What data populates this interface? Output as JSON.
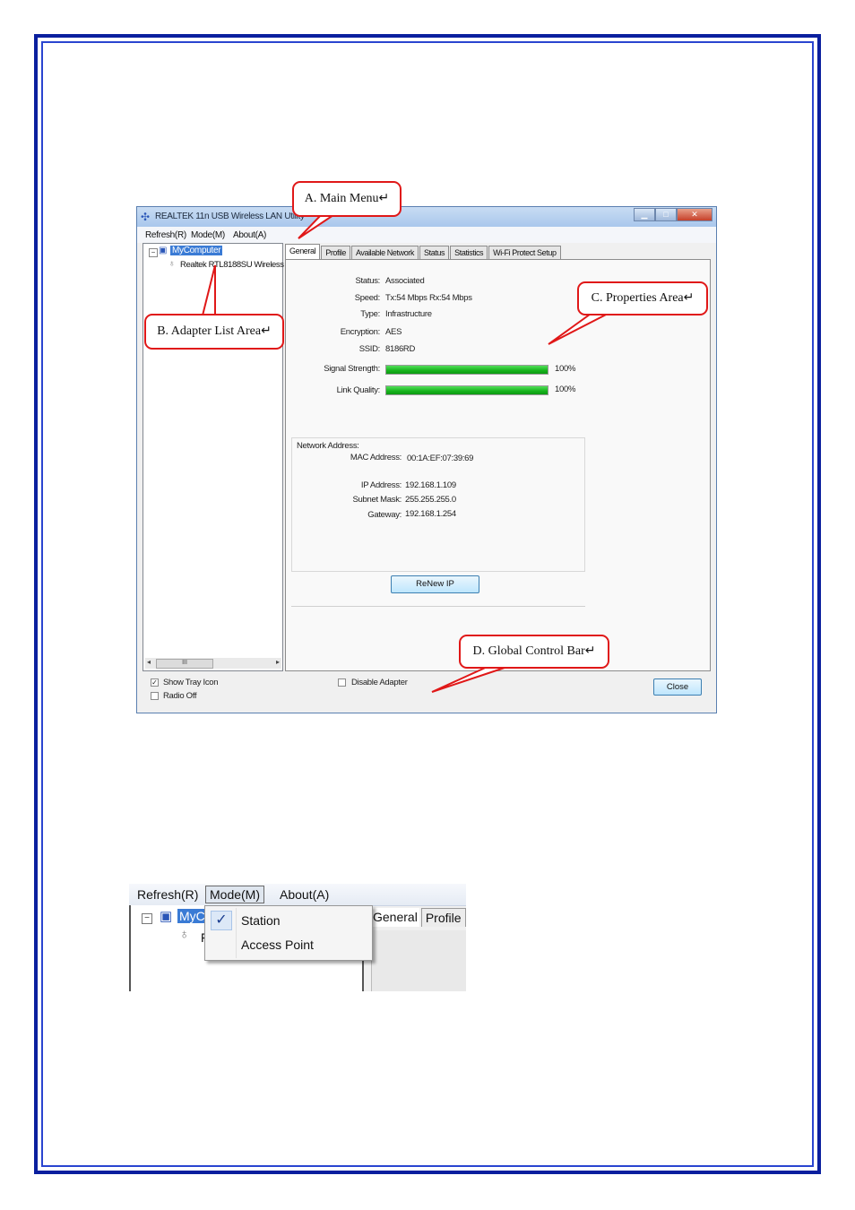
{
  "window": {
    "title": "REALTEK 11n USB Wireless LAN Utility",
    "controls": {
      "minimize": "▁",
      "maximize": "□",
      "close": "✕"
    }
  },
  "menu": {
    "refresh": "Refresh(R)",
    "mode": "Mode(M)",
    "about": "About(A)"
  },
  "adapter_list": {
    "root": "MyComputer",
    "child": "Realtek RTL8188SU Wireless",
    "scroll_thumb": "III"
  },
  "tabs": [
    "General",
    "Profile",
    "Available Network",
    "Status",
    "Statistics",
    "Wi-Fi Protect Setup"
  ],
  "general": {
    "status_label": "Status:",
    "status": "Associated",
    "speed_label": "Speed:",
    "speed": "Tx:54 Mbps Rx:54 Mbps",
    "type_label": "Type:",
    "type": "Infrastructure",
    "encryption_label": "Encryption:",
    "encryption": "AES",
    "ssid_label": "SSID:",
    "ssid": "8186RD",
    "signal_label": "Signal Strength:",
    "signal_text": "100%",
    "signal_value": 100,
    "link_label": "Link Quality:",
    "link_text": "100%",
    "link_value": 100
  },
  "network_address": {
    "heading": "Network Address:",
    "mac_label": "MAC Address:",
    "mac": "00:1A:EF:07:39:69",
    "ip_label": "IP Address:",
    "ip": "192.168.1.109",
    "mask_label": "Subnet Mask:",
    "mask": "255.255.255.0",
    "gateway_label": "Gateway:",
    "gateway": "192.168.1.254"
  },
  "renew_button": "ReNew IP",
  "global_bar": {
    "show_tray": "Show Tray Icon",
    "show_tray_checked": true,
    "radio_off": "Radio Off",
    "radio_off_checked": false,
    "disable_adapter": "Disable Adapter",
    "disable_adapter_checked": false,
    "close": "Close"
  },
  "callouts": {
    "main_menu": "A. Main Menu↵",
    "adapter_list": "B. Adapter List Area↵",
    "properties": "C. Properties Area↵",
    "global_bar": "D. Global Control Bar↵"
  },
  "mode_menu": {
    "menubar": {
      "refresh": "Refresh(R)",
      "mode": "Mode(M)",
      "about": "About(A)"
    },
    "root_partial": "MyC",
    "child_partial": "F",
    "tabs": [
      "General",
      "Profile"
    ],
    "check_mark": "✓",
    "items": [
      "Station",
      "Access Point"
    ]
  },
  "colors": {
    "frame_blue": "#0a1f9e",
    "callout_red": "#e01818",
    "bar_green": "#16b21c",
    "selection_blue": "#3a7bd5"
  }
}
